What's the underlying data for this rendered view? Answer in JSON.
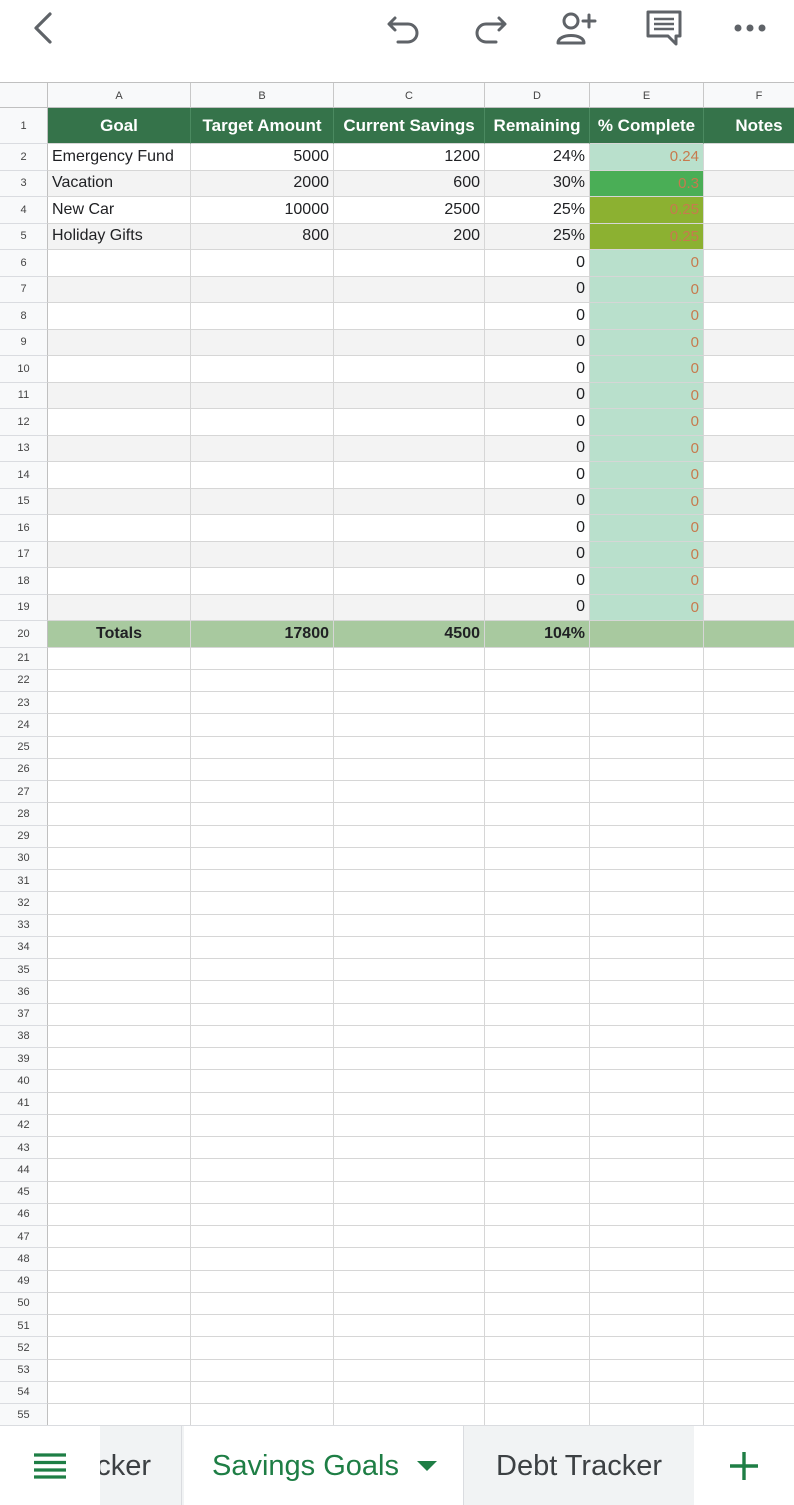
{
  "toolbar": {
    "back_icon": "chevron-left-icon",
    "undo_icon": "undo-icon",
    "redo_icon": "redo-icon",
    "share_icon": "add-person-icon",
    "comment_icon": "comment-icon",
    "more_icon": "more-horizontal-icon"
  },
  "columns": [
    "A",
    "B",
    "C",
    "D",
    "E",
    "F"
  ],
  "header_row": [
    "Goal",
    "Target Amount",
    "Current Savings",
    "Remaining",
    "% Complete",
    "Notes"
  ],
  "data_rows": [
    {
      "goal": "Emergency Fund",
      "target": "5000",
      "current": "1200",
      "remaining": "24%",
      "complete": "0.24",
      "level": "lt"
    },
    {
      "goal": "Vacation",
      "target": "2000",
      "current": "600",
      "remaining": "30%",
      "complete": "0.3",
      "level": "hi"
    },
    {
      "goal": "New Car",
      "target": "10000",
      "current": "2500",
      "remaining": "25%",
      "complete": "0.25",
      "level": "md"
    },
    {
      "goal": "Holiday Gifts",
      "target": "800",
      "current": "200",
      "remaining": "25%",
      "complete": "0.25",
      "level": "md"
    }
  ],
  "empty_formula_rows": {
    "remaining": "0",
    "complete": "0"
  },
  "totals": {
    "label": "Totals",
    "target": "17800",
    "current": "4500",
    "remaining": "104%"
  },
  "last_row_number": 55,
  "sheets": {
    "menu_icon": "sheet-list-icon",
    "partial_tab": "cker",
    "active_tab": "Savings Goals",
    "other_tab": "Debt Tracker",
    "add_icon": "plus-icon"
  },
  "colors": {
    "header_green": "#35734a",
    "totals_green": "#a8c99f",
    "accent_green": "#1e7e45",
    "pct_light": "#b9e0cc",
    "pct_high": "#4aae56",
    "pct_mid": "#8cb131"
  }
}
